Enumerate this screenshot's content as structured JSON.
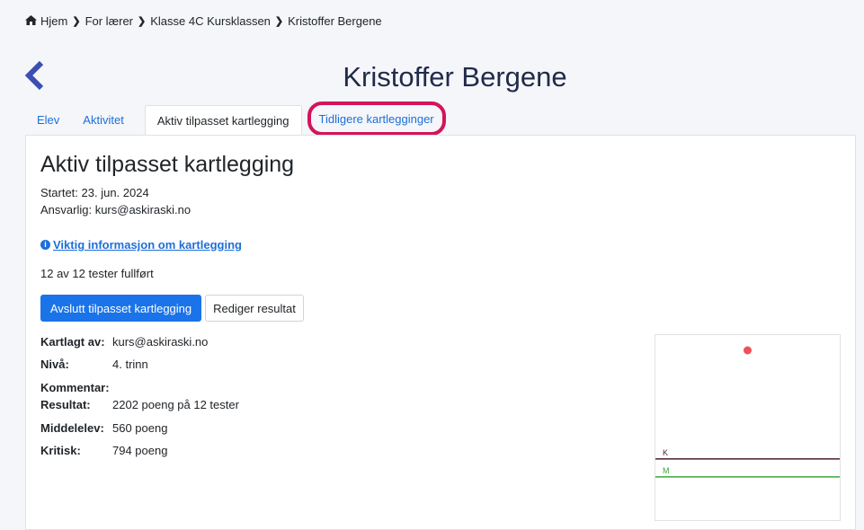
{
  "breadcrumb": {
    "items": [
      "Hjem",
      "For lærer",
      "Klasse 4C Kursklassen",
      "Kristoffer Bergene"
    ]
  },
  "header": {
    "title": "Kristoffer Bergene"
  },
  "tabs": [
    {
      "label": "Elev"
    },
    {
      "label": "Aktivitet"
    },
    {
      "label": "Aktiv tilpasset kartlegging"
    },
    {
      "label": "Tidligere kartlegginger"
    }
  ],
  "main": {
    "title": "Aktiv tilpasset kartlegging",
    "started": "Startet: 23. jun. 2024",
    "responsible": "Ansvarlig: kurs@askiraski.no",
    "info_link": "Viktig informasjon om kartlegging",
    "progress_text": "12 av 12 tester fullført",
    "buttons": {
      "finish": "Avslutt tilpasset kartlegging",
      "edit": "Rediger resultat"
    },
    "details": [
      {
        "label": "Kartlagt av:",
        "value": "kurs@askiraski.no"
      },
      {
        "label": "Nivå:",
        "value": "4. trinn"
      },
      {
        "label": "Kommentar:",
        "value": ""
      },
      {
        "label": "Resultat:",
        "value": "2202 poeng på 12 tester"
      },
      {
        "label": "Middelelev:",
        "value": "560 poeng"
      },
      {
        "label": "Kritisk:",
        "value": "794 poeng"
      }
    ]
  },
  "chart_data": {
    "type": "scatter",
    "points": [
      {
        "y": 2202
      }
    ],
    "reference_lines": [
      {
        "label": "K",
        "y": 794,
        "color": "#4a1f2a"
      },
      {
        "label": "M",
        "y": 560,
        "color": "#3aa63a"
      }
    ],
    "point_color": "#f0505a",
    "ylim": [
      0,
      2400
    ]
  },
  "colors": {
    "accent": "#1a73e8",
    "highlight": "#d4145a",
    "title": "#222a4a"
  }
}
